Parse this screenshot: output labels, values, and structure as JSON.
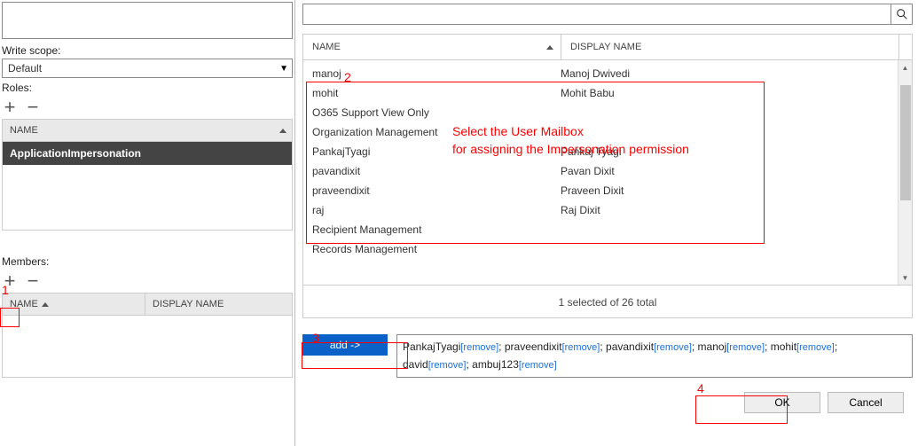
{
  "left": {
    "write_scope_label": "Write scope:",
    "write_scope_value": "Default",
    "roles_label": "Roles:",
    "roles_header_name": "NAME",
    "role_selected": "ApplicationImpersonation",
    "members_label": "Members:",
    "members_header_name": "NAME",
    "members_header_display": "DISPLAY NAME"
  },
  "right": {
    "search_value": "",
    "header_name": "NAME",
    "header_display": "DISPLAY NAME",
    "rows": [
      {
        "name": "manoj",
        "display": "Manoj Dwivedi"
      },
      {
        "name": "mohit",
        "display": "Mohit Babu"
      },
      {
        "name": "O365 Support View Only",
        "display": ""
      },
      {
        "name": "Organization Management",
        "display": ""
      },
      {
        "name": "PankajTyagi",
        "display": "Pankaj Tyagi"
      },
      {
        "name": "pavandixit",
        "display": "Pavan Dixit"
      },
      {
        "name": "praveendixit",
        "display": "Praveen Dixit"
      },
      {
        "name": "raj",
        "display": "Raj Dixit"
      },
      {
        "name": "Recipient Management",
        "display": ""
      },
      {
        "name": "Records Management",
        "display": ""
      }
    ],
    "status": "1 selected of 26 total",
    "add_label": "add ->",
    "added": [
      {
        "name": "PankajTyagi"
      },
      {
        "name": "praveendixit"
      },
      {
        "name": "pavandixit"
      },
      {
        "name": "manoj"
      },
      {
        "name": "mohit"
      },
      {
        "name": "david"
      },
      {
        "name": "ambuj123"
      }
    ],
    "remove_label": "remove",
    "ok_label": "OK",
    "cancel_label": "Cancel"
  },
  "annotations": {
    "n1": "1",
    "n2": "2",
    "n3": "3",
    "n4": "4",
    "sel_line1": "Select the User Mailbox",
    "sel_line2": "for assigning the Impersonation permission"
  }
}
